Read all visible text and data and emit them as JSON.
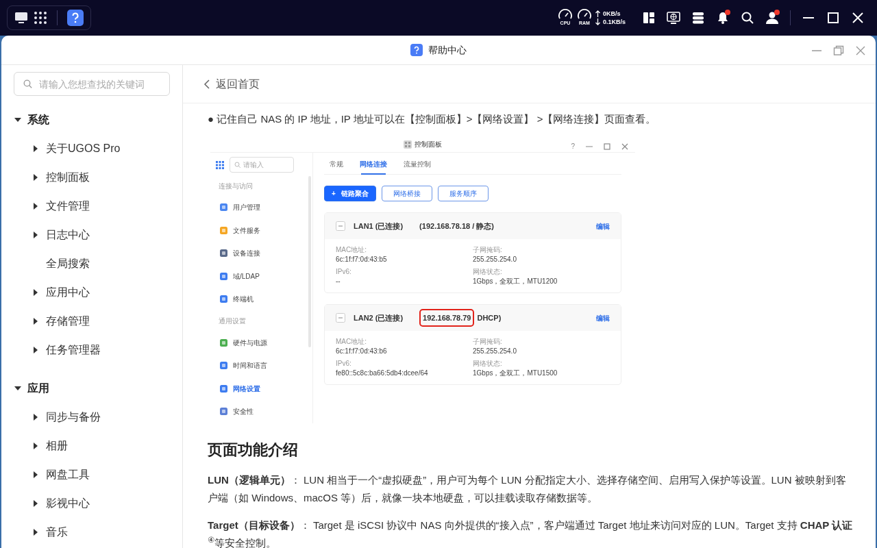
{
  "taskbar": {
    "cpu_label": "CPU",
    "ram_label": "RAM",
    "upload": "0KB/s",
    "download": "0.1KB/s",
    "tray": [
      {
        "badge": false
      },
      {
        "badge": false
      },
      {
        "badge": false
      },
      {
        "badge": true
      },
      {
        "badge": false
      },
      {
        "badge": true
      }
    ]
  },
  "window": {
    "title": "帮助中心"
  },
  "search": {
    "placeholder": "请输入您想查找的关键词"
  },
  "sidebar": {
    "sections": [
      {
        "label": "系统",
        "expanded": true,
        "children": [
          {
            "label": "关于UGOS Pro",
            "kind": "group",
            "expanded": false
          },
          {
            "label": "控制面板",
            "kind": "group",
            "expanded": false
          },
          {
            "label": "文件管理",
            "kind": "group",
            "expanded": false
          },
          {
            "label": "日志中心",
            "kind": "group",
            "expanded": false
          },
          {
            "label": "全局搜索",
            "kind": "page"
          },
          {
            "label": "应用中心",
            "kind": "group",
            "expanded": false
          },
          {
            "label": "存储管理",
            "kind": "group",
            "expanded": false
          },
          {
            "label": "任务管理器",
            "kind": "group",
            "expanded": false
          }
        ]
      },
      {
        "label": "应用",
        "expanded": true,
        "children": [
          {
            "label": "同步与备份",
            "kind": "group",
            "expanded": false
          },
          {
            "label": "相册",
            "kind": "group",
            "expanded": false
          },
          {
            "label": "网盘工具",
            "kind": "group",
            "expanded": false
          },
          {
            "label": "影视中心",
            "kind": "group",
            "expanded": false
          },
          {
            "label": "音乐",
            "kind": "group",
            "expanded": false
          }
        ]
      }
    ]
  },
  "back_link": "返回首页",
  "article": {
    "bullet": "● 记住自己 NAS 的 IP 地址，IP 地址可以在【控制面板】>【网络设置】 >【网络连接】页面查看。",
    "screenshot": {
      "title": "控制面板",
      "help": "?",
      "search_placeholder": "请输入",
      "nav": [
        {
          "kind": "header",
          "label": "连接与访问"
        },
        {
          "kind": "item",
          "label": "用户管理",
          "selected": false
        },
        {
          "kind": "item",
          "label": "文件服务",
          "selected": false
        },
        {
          "kind": "item",
          "label": "设备连接",
          "selected": false
        },
        {
          "kind": "item",
          "label": "域/LDAP",
          "selected": false
        },
        {
          "kind": "item",
          "label": "终端机",
          "selected": false
        },
        {
          "kind": "header",
          "label": "通用设置"
        },
        {
          "kind": "item",
          "label": "硬件与电源",
          "selected": false
        },
        {
          "kind": "item",
          "label": "时间和语言",
          "selected": false
        },
        {
          "kind": "item",
          "label": "网络设置",
          "selected": true
        },
        {
          "kind": "item",
          "label": "安全性",
          "selected": false
        }
      ],
      "tabs": [
        {
          "label": "常规",
          "selected": false
        },
        {
          "label": "网络连接",
          "selected": true
        },
        {
          "label": "流量控制",
          "selected": false
        }
      ],
      "buttons": [
        {
          "label": "链路聚合",
          "kind": "primary",
          "icon": "+"
        },
        {
          "label": "网络桥接",
          "kind": "outline"
        },
        {
          "label": "服务顺序",
          "kind": "outline"
        }
      ],
      "connections": [
        {
          "name": "LAN1 (已连接)",
          "ip": "(192.168.78.18 / 静态)",
          "highlighted": false,
          "expanded": true,
          "edit": "编辑",
          "fields": [
            {
              "label": "MAC地址:",
              "value": "6c:1f:f7:0d:43:b5"
            },
            {
              "label": "子网掩码:",
              "value": "255.255.254.0"
            },
            {
              "label": "IPv6:",
              "value": "--"
            },
            {
              "label": "网络状态:",
              "value": "1Gbps，全双工，MTU1200"
            }
          ]
        },
        {
          "name": "LAN2 (已连接)",
          "ip": "192.168.78.79",
          "ip_suffix": "DHCP)",
          "highlighted": true,
          "expanded": true,
          "edit": "编辑",
          "fields": [
            {
              "label": "MAC地址:",
              "value": "6c:1f:f7:0d:43:b6"
            },
            {
              "label": "子网掩码:",
              "value": "255.255.254.0"
            },
            {
              "label": "IPv6:",
              "value": "fe80::5c8c:ba66:5db4:dcee/64"
            },
            {
              "label": "网络状态:",
              "value": "1Gbps，全双工，MTU1500"
            }
          ]
        }
      ]
    },
    "heading": "页面功能介绍",
    "paragraphs": [
      "**LUN（逻辑单元）**： LUN 相当于一个“虚拟硬盘”，用户可为每个 LUN 分配指定大小、选择存储空间、启用写入保护等设置。LUN 被映射到客户端（如 Windows、macOS 等）后，就像一块本地硬盘，可以挂载读取存储数据等。",
      "**Target（目标设备）**： Target 是 iSCSI 协议中 NAS 向外提供的“接入点”，客户端通过 Target 地址来访问对应的 LUN。Target 支持 **CHAP 认证**$^{④}$等安全控制。"
    ]
  }
}
